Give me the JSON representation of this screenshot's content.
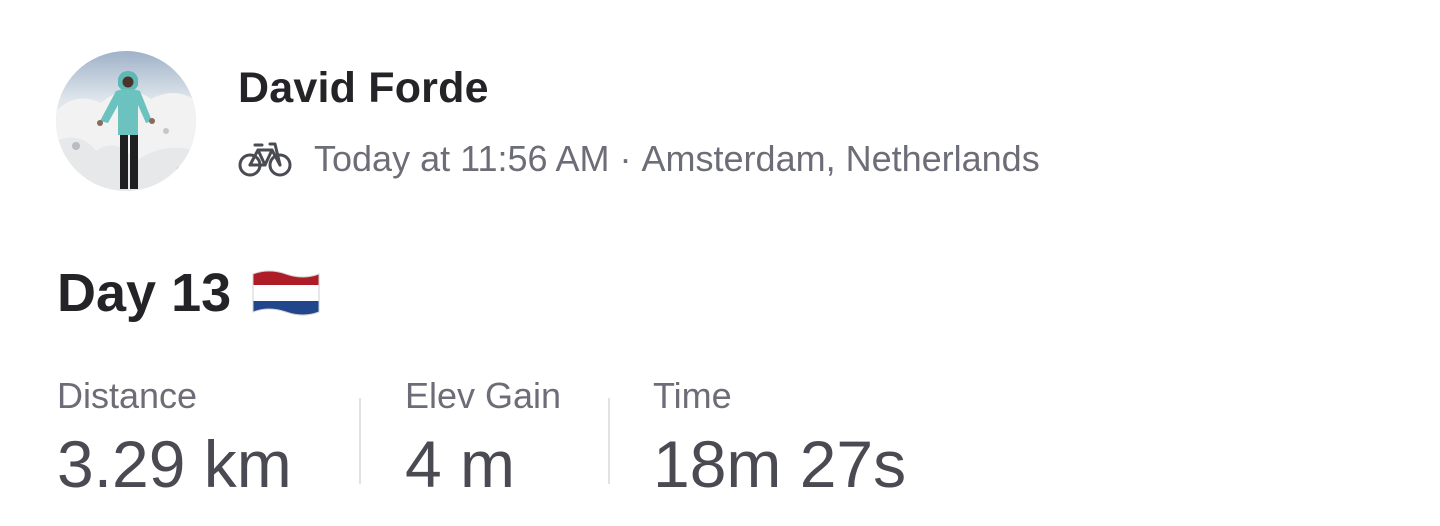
{
  "athlete": {
    "name": "David Forde"
  },
  "activity": {
    "type_icon": "bicycle-icon",
    "timestamp": "Today at 11:56 AM",
    "separator": "·",
    "location": "Amsterdam, Netherlands",
    "title": "Day 13",
    "title_emoji": "netherlands-flag"
  },
  "stats": [
    {
      "label": "Distance",
      "value": "3.29 km"
    },
    {
      "label": "Elev Gain",
      "value": "4 m"
    },
    {
      "label": "Time",
      "value": "18m 27s"
    }
  ],
  "colors": {
    "primary_text": "#242428",
    "secondary_text": "#6d6d78",
    "divider": "#e2e2e6",
    "flag_red": "#AE1C28",
    "flag_white": "#FFFFFF",
    "flag_blue": "#21468B"
  }
}
